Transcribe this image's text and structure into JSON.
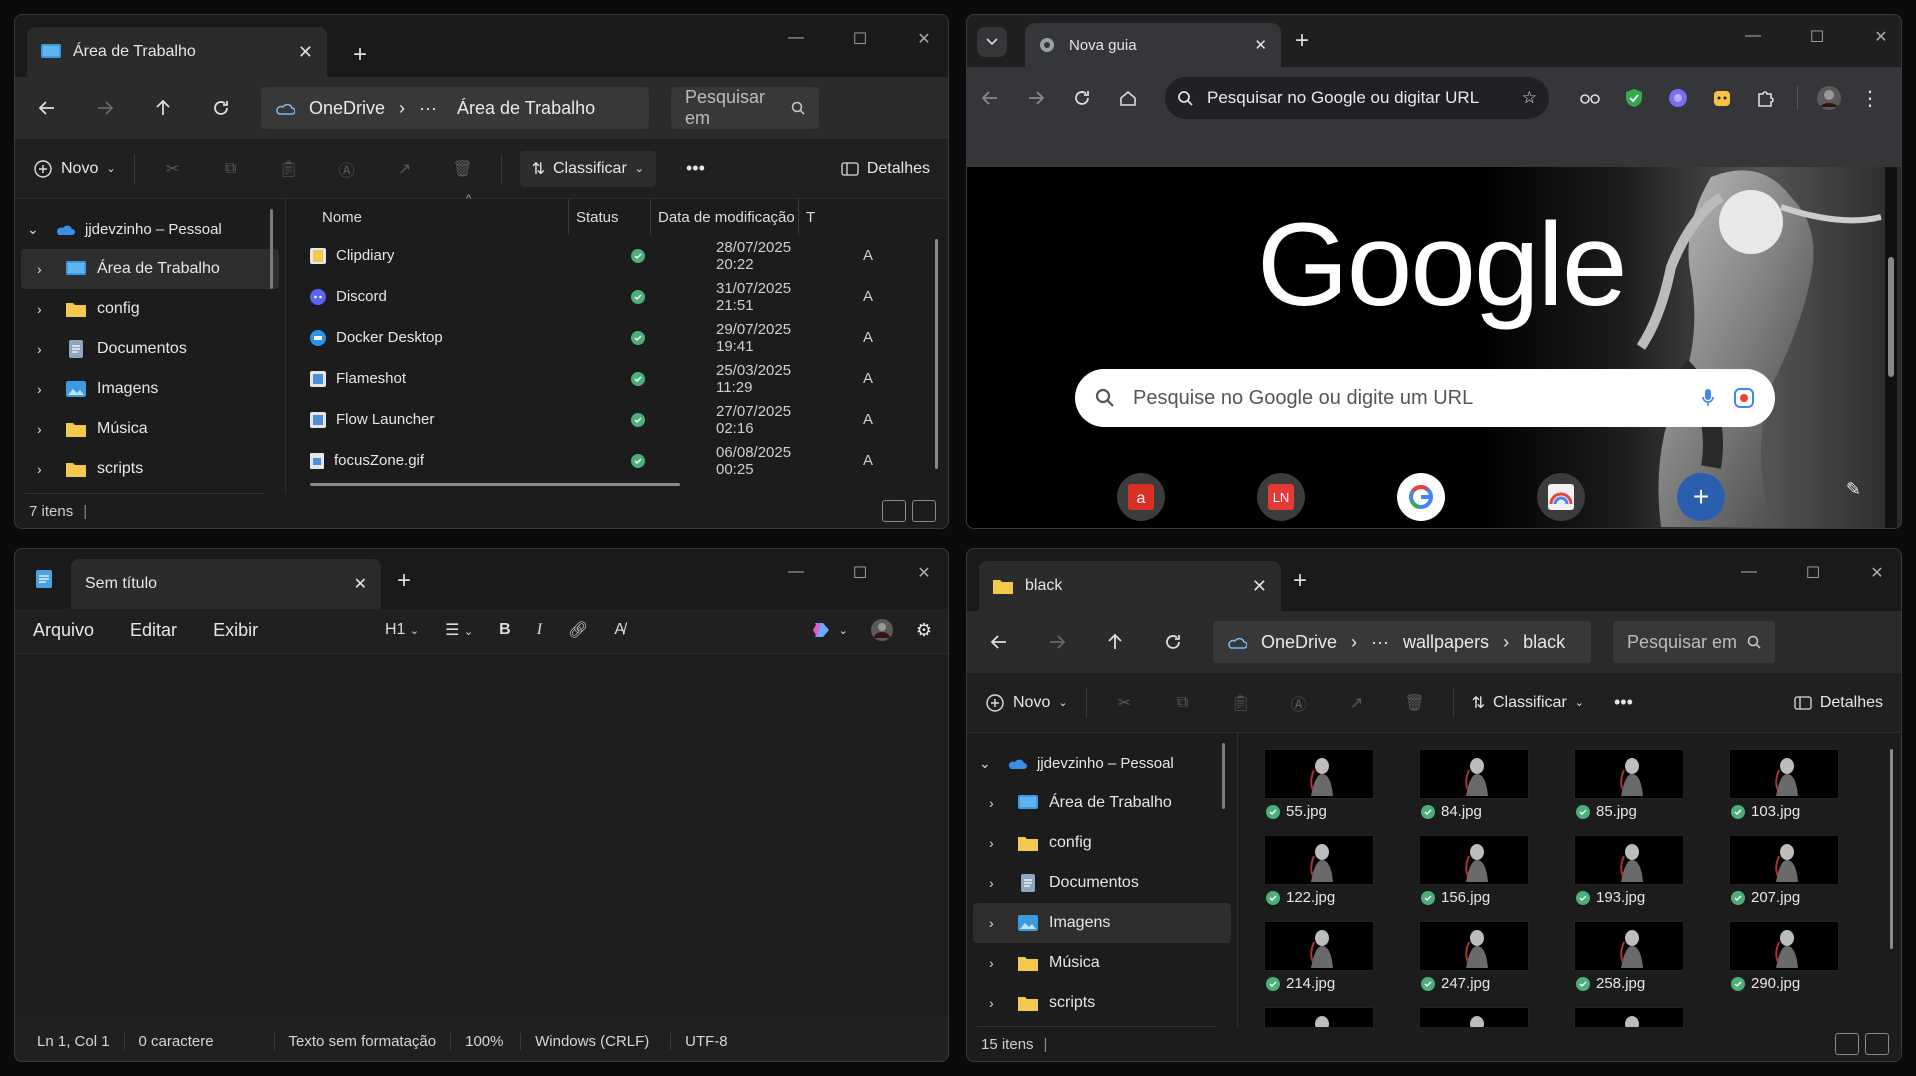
{
  "explorer1": {
    "tab_title": "Área de Trabalho",
    "breadcrumb": {
      "root": "OneDrive",
      "ellipsis": "···",
      "current": "Área de Trabalho"
    },
    "search_placeholder": "Pesquisar em",
    "toolbar": {
      "new": "Novo",
      "sort": "Classificar",
      "more": "•••",
      "details": "Detalhes"
    },
    "tree": {
      "root": "jjdevzinho – Pessoal",
      "items": [
        {
          "label": "Área de Trabalho",
          "icon": "desktop-folder-icon"
        },
        {
          "label": "config",
          "icon": "folder-icon"
        },
        {
          "label": "Documentos",
          "icon": "documents-icon"
        },
        {
          "label": "Imagens",
          "icon": "pictures-icon"
        },
        {
          "label": "Música",
          "icon": "folder-icon"
        },
        {
          "label": "scripts",
          "icon": "folder-icon"
        }
      ]
    },
    "columns": [
      "Nome",
      "Status",
      "Data de modificação",
      "T"
    ],
    "files": [
      {
        "name": "Clipdiary",
        "date": "28/07/2025 20:22",
        "type": "A"
      },
      {
        "name": "Discord",
        "date": "31/07/2025 21:51",
        "type": "A"
      },
      {
        "name": "Docker Desktop",
        "date": "29/07/2025 19:41",
        "type": "A"
      },
      {
        "name": "Flameshot",
        "date": "25/03/2025 11:29",
        "type": "A"
      },
      {
        "name": "Flow Launcher",
        "date": "27/07/2025 02:16",
        "type": "A"
      },
      {
        "name": "focusZone.gif",
        "date": "06/08/2025 00:25",
        "type": "A"
      }
    ],
    "status": "7 itens"
  },
  "chrome": {
    "tab_title": "Nova guia",
    "omnibox_placeholder": "Pesquisar no Google ou digitar URL",
    "logo": "Google",
    "search_placeholder": "Pesquise no Google ou digite um URL"
  },
  "notepad": {
    "tab_title": "Sem título",
    "menu": [
      "Arquivo",
      "Editar",
      "Exibir"
    ],
    "heading": "H1",
    "status": {
      "position": "Ln 1, Col 1",
      "chars": "0 caractere",
      "format": "Texto sem formatação",
      "zoom": "100%",
      "eol": "Windows (CRLF)",
      "encoding": "UTF-8"
    }
  },
  "explorer2": {
    "tab_title": "black",
    "breadcrumb": {
      "root": "OneDrive",
      "ellipsis": "···",
      "parent": "wallpapers",
      "current": "black"
    },
    "search_placeholder": "Pesquisar em",
    "toolbar": {
      "new": "Novo",
      "sort": "Classificar",
      "more": "•••",
      "details": "Detalhes"
    },
    "tree": {
      "root": "jjdevzinho – Pessoal",
      "items": [
        {
          "label": "Área de Trabalho",
          "icon": "desktop-folder-icon"
        },
        {
          "label": "config",
          "icon": "folder-icon"
        },
        {
          "label": "Documentos",
          "icon": "documents-icon"
        },
        {
          "label": "Imagens",
          "icon": "pictures-icon"
        },
        {
          "label": "Música",
          "icon": "folder-icon"
        },
        {
          "label": "scripts",
          "icon": "folder-icon"
        }
      ]
    },
    "images": [
      "55.jpg",
      "84.jpg",
      "85.jpg",
      "103.jpg",
      "122.jpg",
      "156.jpg",
      "193.jpg",
      "207.jpg",
      "214.jpg",
      "247.jpg",
      "258.jpg",
      "290.jpg",
      "",
      "",
      ""
    ],
    "status": "15 itens"
  }
}
